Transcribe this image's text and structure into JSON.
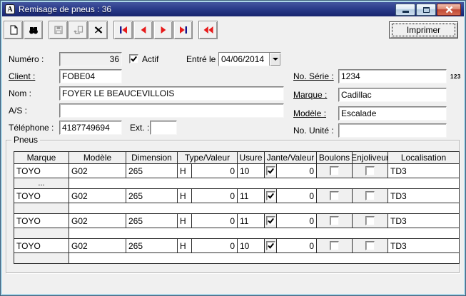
{
  "window": {
    "title": "Remisage de pneus : 36",
    "app_icon_letter": "A",
    "control_icons": [
      "minimize-icon",
      "restore-icon",
      "close-icon"
    ]
  },
  "colors": {
    "titlebar_blue": "#2b3c8b",
    "close_red": "#c04936",
    "nav_arrow_red": "#e71a1a",
    "nav_bar_navy": "#14148c",
    "window_border_blue": "#acd6e8",
    "body_gray": "#f0f0f0"
  },
  "toolbar": {
    "icons": [
      "new-document",
      "find",
      "save",
      "revert",
      "delete",
      "first-record",
      "previous-record",
      "next-record",
      "last-record",
      "previous-block"
    ],
    "imprimer_label": "Imprimer"
  },
  "form": {
    "numero": {
      "label": "Numéro :",
      "value": "36"
    },
    "actif": {
      "label": "Actif",
      "checked": true
    },
    "entre_le": {
      "label": "Entré le :",
      "value": "04/06/2014"
    },
    "client": {
      "label": "Client :",
      "value": "FOBE04"
    },
    "no_serie": {
      "label": "No. Série :",
      "value": "1234",
      "badge": "123"
    },
    "nom": {
      "label": "Nom :",
      "value": "FOYER LE BEAUCEVILLOIS"
    },
    "marque": {
      "label": "Marque :",
      "value": "Cadillac"
    },
    "a_s": {
      "label": "A/S :",
      "value": ""
    },
    "modele": {
      "label": "Modèle :",
      "value": "Escalade"
    },
    "telephone": {
      "label": "Téléphone :",
      "value": "4187749694"
    },
    "ext": {
      "label": "Ext. :",
      "value": ""
    },
    "no_unite": {
      "label": "No. Unité :",
      "value": ""
    }
  },
  "pneus": {
    "group_label": "Pneus",
    "columns": [
      "Marque",
      "Modèle",
      "Dimension",
      "Type/Valeur",
      "Usure",
      "Jante/Valeur",
      "Boulons",
      "Enjoliveur",
      "Localisation"
    ],
    "rows": [
      {
        "marque": "TOYO",
        "modele": "G02",
        "dimension": "265",
        "type": "H",
        "type_valeur": "0",
        "usure": "10",
        "jante_checked": true,
        "jante_valeur": "0",
        "boulons_checked": false,
        "enjoliveur_checked": false,
        "localisation": "TD3",
        "note": "..."
      },
      {
        "marque": "TOYO",
        "modele": "G02",
        "dimension": "265",
        "type": "H",
        "type_valeur": "0",
        "usure": "11",
        "jante_checked": true,
        "jante_valeur": "0",
        "boulons_checked": false,
        "enjoliveur_checked": false,
        "localisation": "TD3",
        "note": ""
      },
      {
        "marque": "TOYO",
        "modele": "G02",
        "dimension": "265",
        "type": "H",
        "type_valeur": "0",
        "usure": "11",
        "jante_checked": true,
        "jante_valeur": "0",
        "boulons_checked": false,
        "enjoliveur_checked": false,
        "localisation": "TD3",
        "note": ""
      },
      {
        "marque": "TOYO",
        "modele": "G02",
        "dimension": "265",
        "type": "H",
        "type_valeur": "0",
        "usure": "10",
        "jante_checked": true,
        "jante_valeur": "0",
        "boulons_checked": false,
        "enjoliveur_checked": false,
        "localisation": "TD3",
        "note": ""
      }
    ]
  }
}
